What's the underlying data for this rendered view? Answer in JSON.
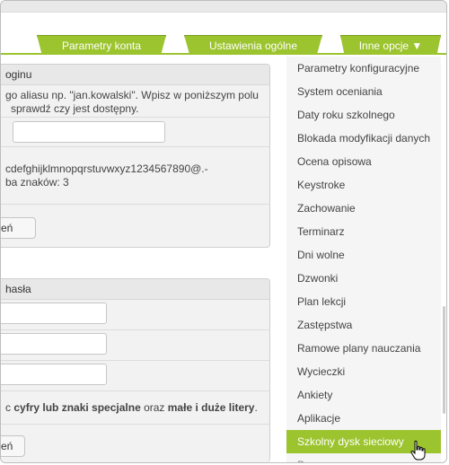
{
  "tabs": [
    {
      "label": "Parametry konta"
    },
    {
      "label": "Ustawienia ogólne"
    },
    {
      "label": "Inne opcje ▼"
    }
  ],
  "login_panel": {
    "header": "oginu",
    "description_line1": "go aliasu np. \"jan.kowalski\". Wpisz w poniższym polu",
    "description_line2": "sprawdź czy jest dostępny.",
    "alias_input_value": "",
    "allowed_chars": "cdefghijklmnopqrstuvwxyz1234567890@.-",
    "min_chars": "ba znaków: 3",
    "button_label": "eń"
  },
  "password_panel": {
    "header": "hasła",
    "field1_value": "",
    "field2_value": "",
    "field3_value": "",
    "rule_prefix": "c ",
    "rule_bold1": "cyfry lub znaki specjalne",
    "rule_mid": " oraz ",
    "rule_bold2": "małe i duże litery",
    "rule_suffix": ".",
    "button_label": "eń"
  },
  "menu": {
    "items": [
      {
        "label": "Parametry konfiguracyjne"
      },
      {
        "label": "System oceniania"
      },
      {
        "label": "Daty roku szkolnego"
      },
      {
        "label": "Blokada modyfikacji danych"
      },
      {
        "label": "Ocena opisowa"
      },
      {
        "label": "Keystroke"
      },
      {
        "label": "Zachowanie"
      },
      {
        "label": "Terminarz"
      },
      {
        "label": "Dni wolne"
      },
      {
        "label": "Dzwonki"
      },
      {
        "label": "Plan lekcji"
      },
      {
        "label": "Zastępstwa"
      },
      {
        "label": "Ramowe plany nauczania"
      },
      {
        "label": "Wycieczki"
      },
      {
        "label": "Ankiety"
      },
      {
        "label": "Aplikacje"
      },
      {
        "label": "Szkolny dysk sieciowy"
      },
      {
        "label": "Dr"
      }
    ],
    "active_index": 16
  },
  "colors": {
    "accent": "#9cc42e",
    "accent_dark": "#7a9e1d"
  },
  "icons": {
    "cursor": "hand-pointer-icon"
  }
}
